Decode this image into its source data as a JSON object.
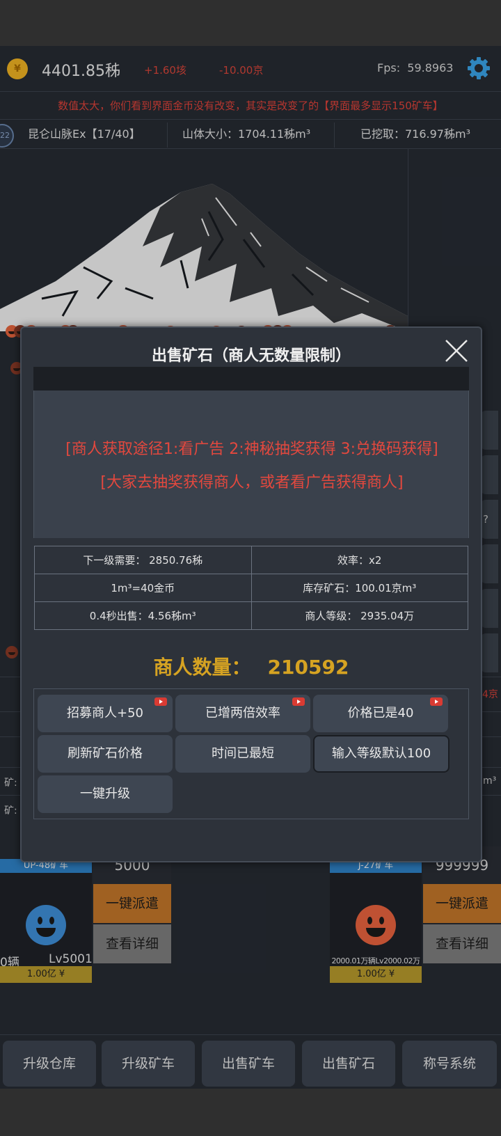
{
  "header": {
    "gold": "4401.85秭",
    "income": "+1.60垓",
    "expense": "-10.00京",
    "fps_label": "Fps:",
    "fps_value": "59.8963",
    "coin_glyph": "¥"
  },
  "notice": "数值太大，你们看到界面金币没有改变，其实是改变了的【界面最多显示150矿车】",
  "info": {
    "level_badge": "22",
    "mountain_name": "昆仑山脉Ex【17/40】",
    "mountain_size": "山体大小：1704.11秭m³",
    "mined": "已挖取：716.97秭m³"
  },
  "side_buttons": {
    "help": "?"
  },
  "background_rows": {
    "right_red_value": "4京",
    "ore_label_1": "矿:",
    "ore_label_2": "矿:",
    "right_unit": "m³"
  },
  "cards": [
    {
      "tag": "UP-48矿车",
      "count": "0辆",
      "level": "Lv5001",
      "price": "1.00亿 ¥",
      "number": "5000",
      "dispatch": "一键派遣",
      "detail": "查看详细",
      "face_color": "#3f8fd8"
    },
    {
      "tag": "J-27矿车",
      "stats": "2000.01万辆Lv2000.02万",
      "price": "1.00亿 ¥",
      "number": "999999",
      "dispatch": "一键派遣",
      "detail": "查看详细",
      "face_color": "#e9633f"
    }
  ],
  "bottom_nav": [
    "升级仓库",
    "升级矿车",
    "出售矿车",
    "出售矿石",
    "称号系统"
  ],
  "modal": {
    "title": "出售矿石（商人无数量限制）",
    "red_line_1": "[商人获取途径1:看广告 2:神秘抽奖获得 3:兑换码获得]",
    "red_line_2": "[大家去抽奖获得商人，或者看广告获得商人]",
    "stats": [
      [
        "下一级需要： 2850.76秭",
        "效率：x2"
      ],
      [
        "1m³=40金币",
        "库存矿石：100.01京m³"
      ],
      [
        "0.4秒出售：4.56秭m³",
        "商人等级： 2935.04万"
      ]
    ],
    "merchant_label": "商人数量：",
    "merchant_count": "210592",
    "buttons": {
      "recruit": "招募商人+50",
      "double": "已增两倍效率",
      "price": "价格已是40",
      "refresh": "刷新矿石价格",
      "time": "时间已最短",
      "input": "输入等级默认100",
      "upgrade": "一键升级"
    }
  },
  "colors": {
    "accent_red": "#e3483e",
    "gold_text": "#d6a322",
    "blue_tag": "#2f83c9",
    "orange_button": "#c4772a"
  }
}
